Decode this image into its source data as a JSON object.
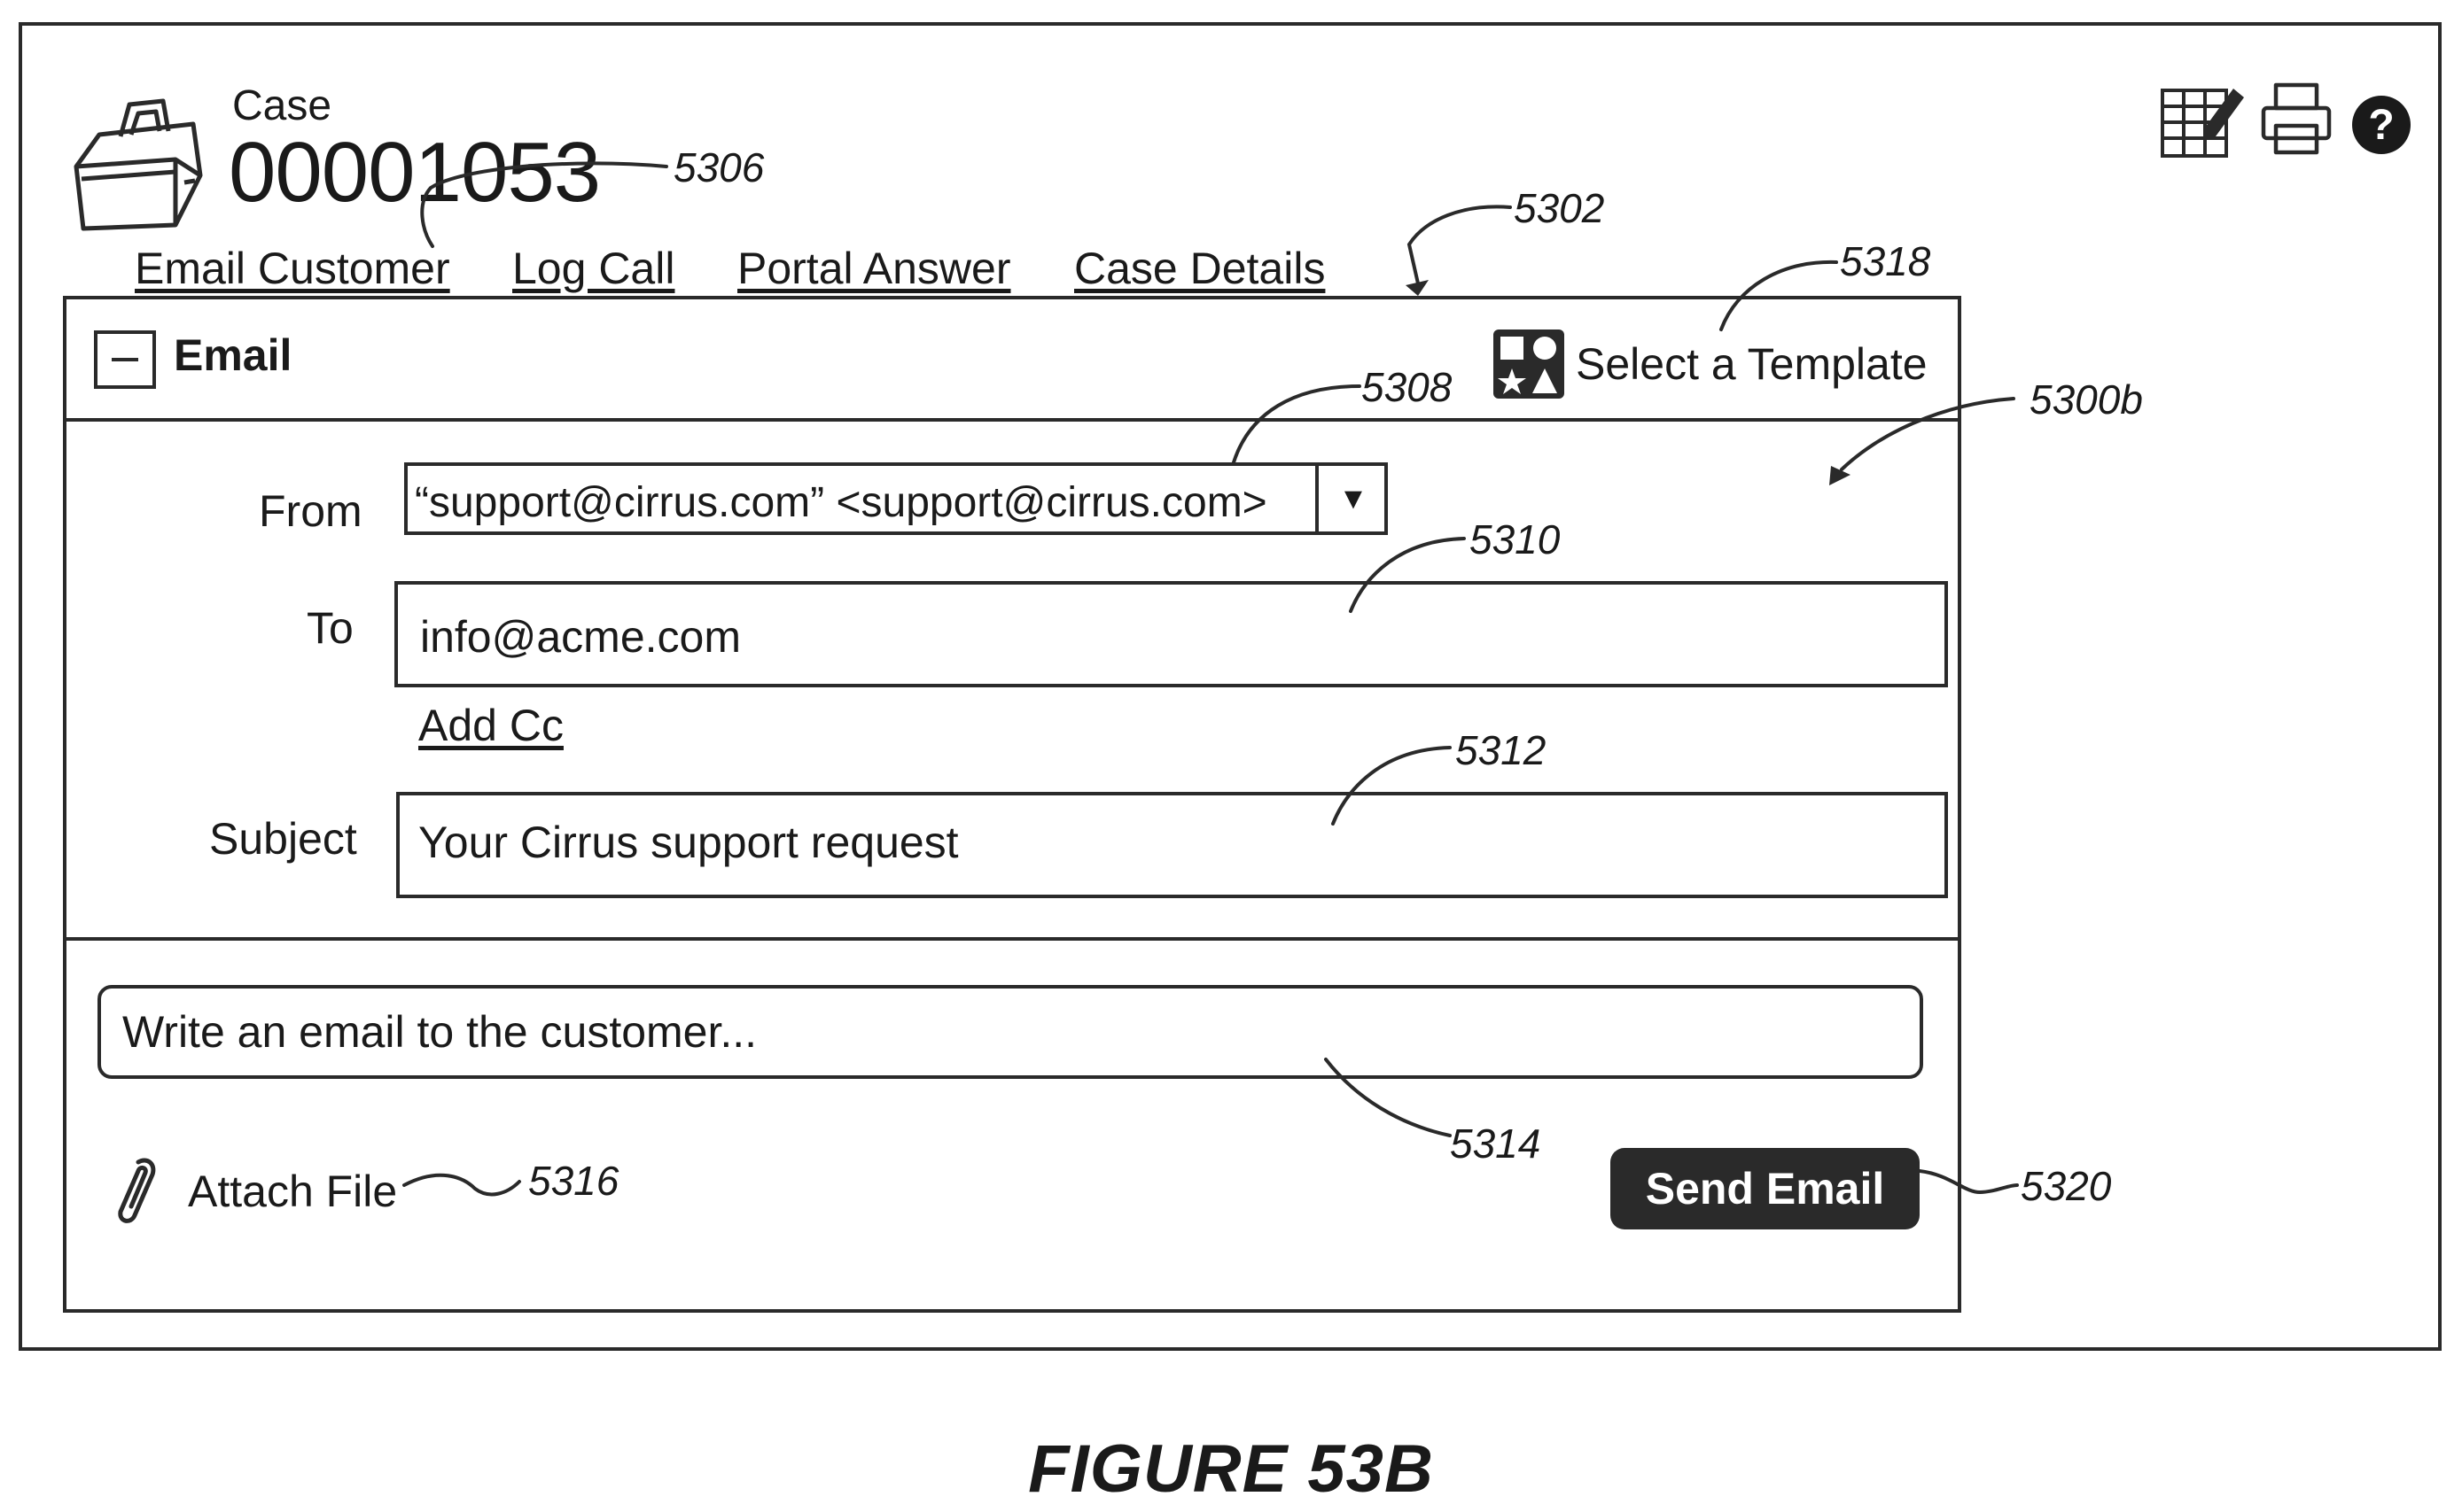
{
  "header": {
    "case_label": "Case",
    "case_number": "00001053",
    "icons": [
      "toolbox-icon",
      "spreadsheet-edit-icon",
      "printer-icon",
      "help-icon"
    ],
    "help_glyph": "?"
  },
  "tabs": [
    {
      "label": "Email Customer"
    },
    {
      "label": "Log Call"
    },
    {
      "label": "Portal Answer"
    },
    {
      "label": "Case Details"
    }
  ],
  "email_panel": {
    "title": "Email",
    "collapse_icon": "minus-box-icon",
    "template_icon": "template-shapes-icon",
    "template_label": "Select a Template",
    "from_label": "From",
    "from_value": "“support@cirrus.com” <support@cirrus.com>",
    "from_dropdown_glyph": "▼",
    "to_label": "To",
    "to_value": "info@acme.com",
    "add_cc_label": "Add Cc",
    "subject_label": "Subject",
    "subject_value": "Your Cirrus support request",
    "body_placeholder": "Write an email to the customer...",
    "attach_icon": "paperclip-icon",
    "attach_label": "Attach File",
    "send_label": "Send Email"
  },
  "reference_numerals": {
    "r5306": "5306",
    "r5302": "5302",
    "r5318": "5318",
    "r5308": "5308",
    "r5300b": "5300b",
    "r5310": "5310",
    "r5312": "5312",
    "r5314": "5314",
    "r5316": "5316",
    "r5320": "5320"
  },
  "figure_caption": "FIGURE 53B",
  "colors": {
    "ink": "#2a2a2a",
    "background": "#ffffff",
    "button_text": "#ffffff"
  }
}
